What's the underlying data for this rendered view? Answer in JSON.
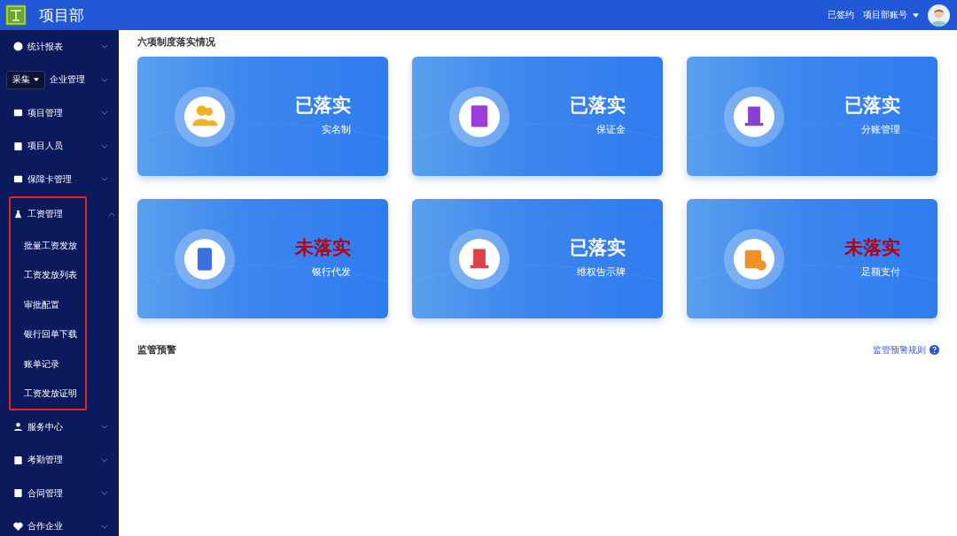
{
  "header": {
    "title": "项目部",
    "links": [
      "已签约"
    ],
    "account": "项目部账号"
  },
  "sidebar": {
    "items": [
      {
        "label": "统计报表",
        "expanded": false
      },
      {
        "label": "企业管理",
        "expanded": false
      },
      {
        "label": "项目管理",
        "expanded": false
      },
      {
        "label": "项目人员",
        "expanded": false
      },
      {
        "label": "保障卡管理",
        "expanded": false
      },
      {
        "label": "工资管理",
        "expanded": true,
        "highlighted": true,
        "children": [
          {
            "label": "批量工资发放"
          },
          {
            "label": "工资发放列表"
          },
          {
            "label": "审批配置"
          },
          {
            "label": "银行回单下载"
          },
          {
            "label": "账单记录"
          },
          {
            "label": "工资发放证明"
          }
        ]
      },
      {
        "label": "服务中心",
        "expanded": false
      },
      {
        "label": "考勤管理",
        "expanded": false
      },
      {
        "label": "合同管理",
        "expanded": false
      },
      {
        "label": "合作企业",
        "expanded": false
      }
    ]
  },
  "popover": {
    "label": "采集"
  },
  "section_title": "六项制度落实情况",
  "cards": [
    {
      "status": "已落实",
      "implemented": true,
      "name": "实名制",
      "color": "#f0b020"
    },
    {
      "status": "已落实",
      "implemented": true,
      "name": "保证金",
      "color": "#9b3bd8"
    },
    {
      "status": "已落实",
      "implemented": true,
      "name": "分账管理",
      "color": "#8a3fd6"
    },
    {
      "status": "未落实",
      "implemented": false,
      "name": "银行代发",
      "color": "#3a6fe0"
    },
    {
      "status": "已落实",
      "implemented": true,
      "name": "维权告示牌",
      "color": "#e0404a"
    },
    {
      "status": "未落实",
      "implemented": false,
      "name": "足额支付",
      "color": "#f0902a"
    }
  ],
  "warning": {
    "title": "监管预警",
    "link": "监管预警规则"
  }
}
